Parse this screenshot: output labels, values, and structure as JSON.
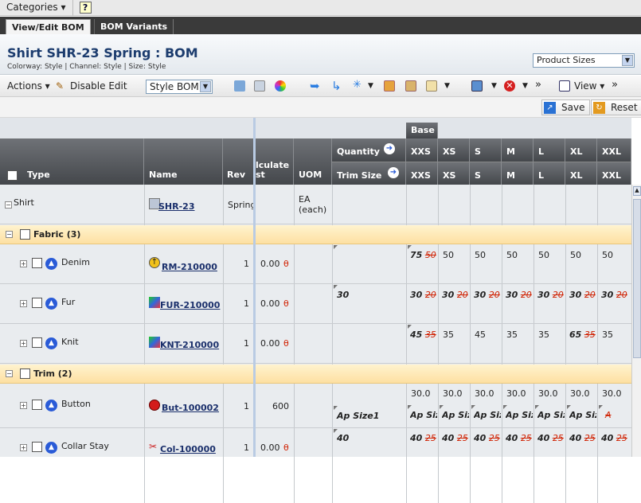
{
  "topbar": {
    "categories": "Categories",
    "categories_arrow": "▾",
    "help": "?"
  },
  "tabs": [
    {
      "label": "View/Edit BOM"
    },
    {
      "label": "BOM Variants"
    }
  ],
  "header": {
    "title": "Shirt SHR-23 Spring : BOM",
    "subtitle": "Colorway: Style | Channel: Style | Size: Style",
    "view_select": "Product Sizes"
  },
  "toolbar": {
    "actions": "Actions",
    "disable_edit": "Disable Edit",
    "bom_select": "Style BOM",
    "more": "»",
    "view": "View"
  },
  "savebar": {
    "save": "Save",
    "reset": "Reset"
  },
  "columns": {
    "type": "Type",
    "name": "Name",
    "rev": "Rev",
    "calc": "lculate\nst",
    "calc1": "lculate",
    "calc2": "st",
    "uom": "UOM",
    "quantity": "Quantity",
    "trim_size": "Trim Size",
    "base": "Base",
    "sizes": [
      "XXS",
      "XS",
      "S",
      "M",
      "L",
      "XL",
      "XXL"
    ]
  },
  "rows": {
    "shirt": {
      "type": "Shirt",
      "name": "SHR-23",
      "rev": "Spring",
      "uom1": "EA",
      "uom2": "(each)"
    },
    "fabric": {
      "label": "Fabric (3)"
    },
    "denim": {
      "type": "Denim",
      "name": "RM-210000",
      "rev": "1",
      "calc": "0.00",
      "calc_x": "θ",
      "xxs": "75",
      "xxs_old": "50",
      "xs": "50",
      "s": "50",
      "m": "50",
      "l": "50",
      "xl": "50",
      "xxl": "50"
    },
    "fur": {
      "type": "Fur",
      "name": "FUR-210000",
      "rev": "1",
      "calc": "0.00",
      "calc_x": "θ",
      "qty": "30",
      "sizes": [
        "30",
        "30",
        "30",
        "30",
        "30",
        "30",
        "30"
      ],
      "old": "20"
    },
    "knit": {
      "type": "Knit",
      "name": "KNT-210000",
      "rev": "1",
      "calc": "0.00",
      "calc_x": "θ",
      "xxs": "45",
      "xxs_old": "35",
      "xs": "35",
      "s": "45",
      "m": "35",
      "l": "35",
      "xl": "65",
      "xl_old": "35",
      "xxl": "35"
    },
    "trim": {
      "label": "Trim (2)"
    },
    "button": {
      "type": "Button",
      "name": "But-100002",
      "rev": "1",
      "calc": "600",
      "qty_size": "Ap Size1",
      "val": "30.0",
      "size": "Ap Size1",
      "xxl_a": "A"
    },
    "collar": {
      "type": "Collar Stay",
      "name": "Col-100000",
      "rev": "1",
      "calc": "0.00",
      "calc_x": "θ",
      "qty": "40",
      "sizes": [
        "40",
        "40",
        "40",
        "40",
        "40",
        "40",
        "40"
      ],
      "old": "25"
    }
  }
}
